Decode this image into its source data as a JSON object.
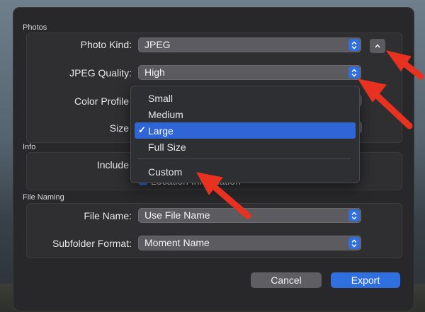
{
  "sections": {
    "photos": "Photos",
    "info": "Info",
    "file_naming": "File Naming"
  },
  "photos": {
    "photo_kind_label": "Photo Kind:",
    "photo_kind_value": "JPEG",
    "jpeg_quality_label": "JPEG Quality:",
    "jpeg_quality_value": "High",
    "color_profile_label": "Color Profile",
    "size_label": "Size"
  },
  "size_menu": {
    "items": [
      "Small",
      "Medium",
      "Large",
      "Full Size",
      "Custom"
    ],
    "selected": "Large",
    "check": "✓"
  },
  "info": {
    "include_label": "Include",
    "location_text": "Location Information"
  },
  "file_naming": {
    "file_name_label": "File Name:",
    "file_name_value": "Use File Name",
    "subfolder_label": "Subfolder Format:",
    "subfolder_value": "Moment Name"
  },
  "buttons": {
    "cancel": "Cancel",
    "export": "Export"
  },
  "colors": {
    "accent": "#2f6fe0",
    "annotation_arrow": "#e8321f"
  },
  "icons": {
    "stepper": "up-down-chevrons-icon",
    "collapse": "chevron-up-icon",
    "check": "checkmark-icon"
  }
}
